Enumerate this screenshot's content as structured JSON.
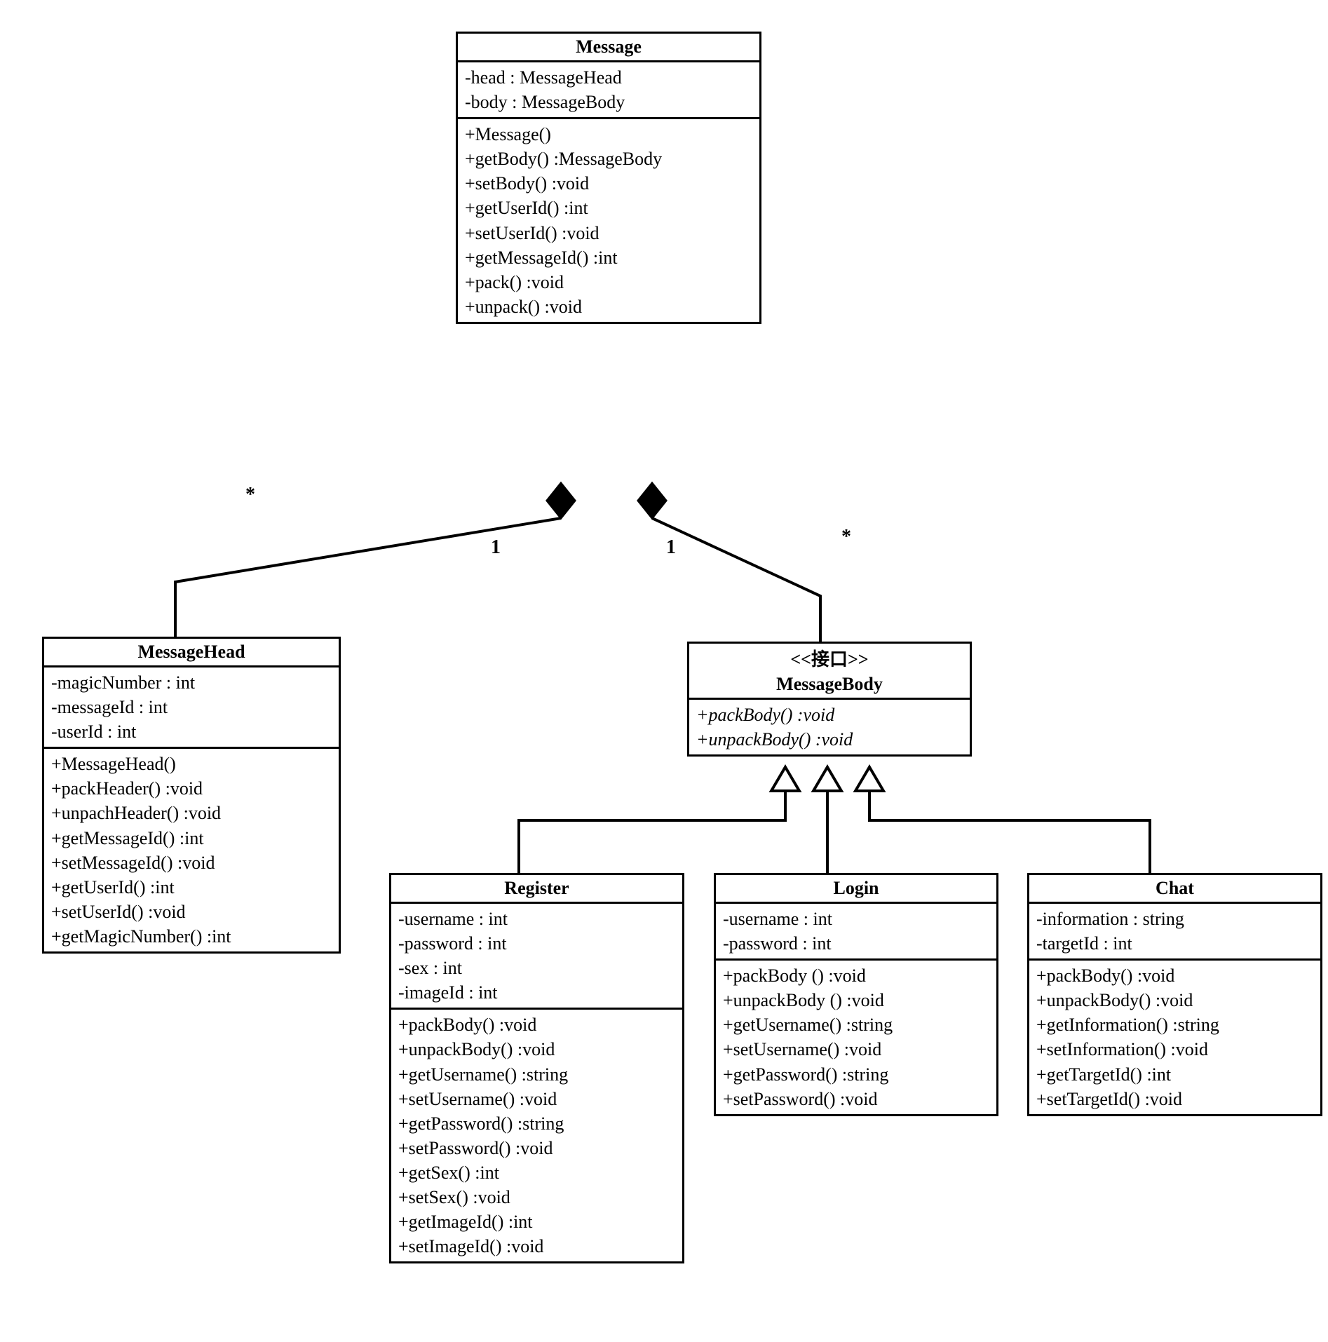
{
  "classes": {
    "Message": {
      "title": "Message",
      "attributes": [
        "-head : MessageHead",
        "-body : MessageBody"
      ],
      "operations": [
        "+Message()",
        "+getBody() :MessageBody",
        "+setBody() :void",
        "+getUserId() :int",
        "+setUserId() :void",
        "+getMessageId() :int",
        "+pack() :void",
        "+unpack() :void"
      ]
    },
    "MessageHead": {
      "title": "MessageHead",
      "attributes": [
        "-magicNumber : int",
        "-messageId : int",
        "-userId : int"
      ],
      "operations": [
        "+MessageHead()",
        "+packHeader() :void",
        "+unpachHeader() :void",
        "+getMessageId() :int",
        "+setMessageId() :void",
        "+getUserId() :int",
        "+setUserId() :void",
        "+getMagicNumber() :int"
      ]
    },
    "MessageBody": {
      "stereotype": "<<接口>>",
      "title": "MessageBody",
      "operations": [
        "+packBody() :void",
        "+unpackBody() :void"
      ]
    },
    "Register": {
      "title": "Register",
      "attributes": [
        "-username : int",
        "-password : int",
        "-sex : int",
        "-imageId : int"
      ],
      "operations": [
        "+packBody() :void",
        "+unpackBody() :void",
        "+getUsername() :string",
        "+setUsername() :void",
        "+getPassword() :string",
        "+setPassword() :void",
        "+getSex() :int",
        "+setSex() :void",
        "+getImageId() :int",
        "+setImageId() :void"
      ]
    },
    "Login": {
      "title": "Login",
      "attributes": [
        "-username : int",
        "-password : int"
      ],
      "operations": [
        "+packBody () :void",
        "+unpackBody () :void",
        "+getUsername() :string",
        "+setUsername() :void",
        "+getPassword() :string",
        "+setPassword() :void"
      ]
    },
    "Chat": {
      "title": "Chat",
      "attributes": [
        "-information : string",
        "-targetId : int"
      ],
      "operations": [
        "+packBody() :void",
        "+unpackBody() :void",
        "+getInformation() :string",
        "+setInformation() :void",
        "+getTargetId() :int",
        "+setTargetId() :void"
      ]
    }
  },
  "multiplicities": {
    "head_star": "*",
    "head_one": "1",
    "body_one": "1",
    "body_star": "*"
  }
}
